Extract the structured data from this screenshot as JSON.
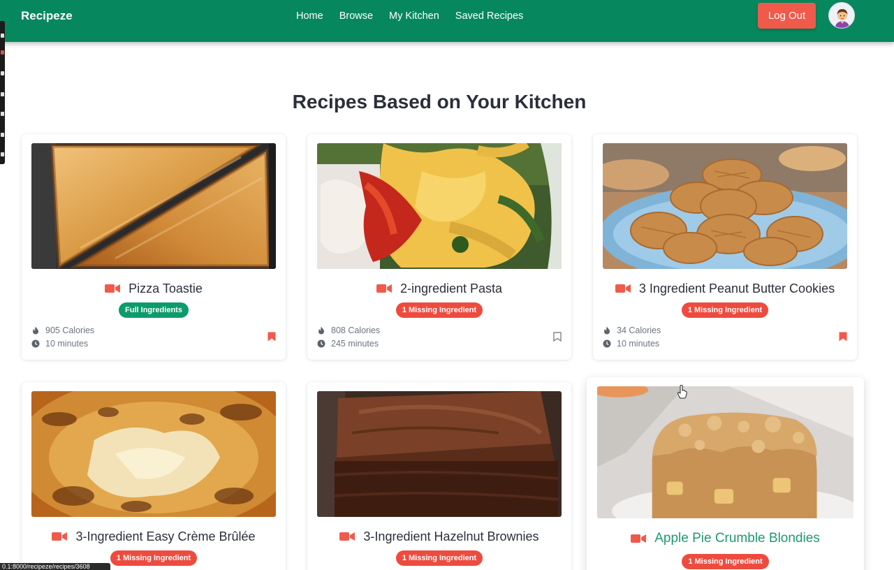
{
  "nav": {
    "brand": "Recipeze",
    "links": [
      "Home",
      "Browse",
      "My Kitchen",
      "Saved Recipes"
    ],
    "logout_label": "Log Out"
  },
  "page": {
    "title": "Recipes Based on Your Kitchen"
  },
  "recipes": [
    {
      "title": "Pizza Toastie",
      "badge": "Full Ingredients",
      "badge_status": "full",
      "calories": "905 Calories",
      "time": "10 minutes",
      "saved": true,
      "image": "toastie"
    },
    {
      "title": "2-ingredient Pasta",
      "badge": "1 Missing Ingredient",
      "badge_status": "missing",
      "calories": "808 Calories",
      "time": "245 minutes",
      "saved": false,
      "image": "pasta"
    },
    {
      "title": "3 Ingredient Peanut Butter Cookies",
      "badge": "1 Missing Ingredient",
      "badge_status": "missing",
      "calories": "34 Calories",
      "time": "10 minutes",
      "saved": true,
      "image": "cookies"
    },
    {
      "title": "3-Ingredient Easy Crème Brûlée",
      "badge": "1 Missing Ingredient",
      "badge_status": "missing",
      "image": "bruleee"
    },
    {
      "title": "3-Ingredient Hazelnut Brownies",
      "badge": "1 Missing Ingredient",
      "badge_status": "missing",
      "image": "brownies"
    },
    {
      "title": "Apple Pie Crumble Blondies",
      "badge": "1 Missing Ingredient",
      "badge_status": "missing",
      "image": "blondies",
      "hovered": true
    }
  ],
  "colors": {
    "nav_bg": "#07875d",
    "logout_bg": "#f05a4b",
    "badge_full": "#0e9b6b",
    "badge_missing": "#ee4b3f",
    "icon_red": "#f05a4b",
    "hover_title": "#1e9a70"
  },
  "icons": {
    "video": "video-camera-icon",
    "calories": "fire-icon",
    "time": "clock-icon",
    "bookmark": "bookmark-icon"
  },
  "status_bar": {
    "url": "0.1:8000/recipeze/recipes/3608"
  }
}
